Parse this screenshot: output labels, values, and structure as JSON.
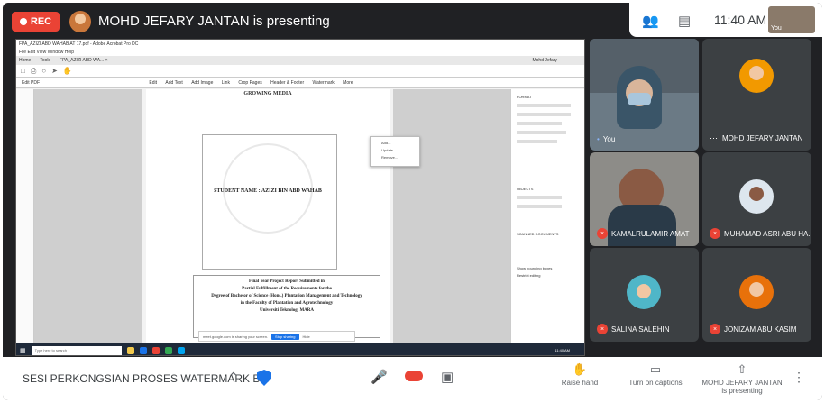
{
  "top": {
    "rec_label": "REC",
    "presenting_title": "MOHD JEFARY JANTAN is presenting",
    "clock": "11:40 AM",
    "self_label": "You"
  },
  "shared_screen": {
    "acrobat_title": "FPA_AZIZI ABD WAHAB AT 17.pdf - Adobe Acrobat Pro DC",
    "acrobat_menu": "File  Edit  View  Window  Help",
    "tabs": [
      "Home",
      "Tools",
      "FPA_AZIZI ABD WA... ×"
    ],
    "user_name": "Mohd Jefary",
    "edit_label": "Edit PDF",
    "toolbar_items": [
      "Edit",
      "Add Text",
      "Add Image",
      "Link",
      "Crop Pages",
      "Header & Footer",
      "Watermark",
      "More"
    ],
    "dropdown_items": [
      "Add...",
      "Update...",
      "Remove..."
    ],
    "page_heading": "GROWING MEDIA",
    "student_name": "STUDENT NAME : AZIZI BIN ABD WAHAB",
    "report_lines": [
      "Final Year Project Report Submitted in",
      "Partial Fulfillment of the Requirements for the",
      "Degree of Bachelor of Science (Hons.) Plantation Management and Technology",
      "in the Faculty of Plantation and Agrotechnology",
      "Universiti Teknologi MARA"
    ],
    "share_banner_text": "meet.google.com is sharing your screen.",
    "share_banner_stop": "Stop sharing",
    "share_banner_hide": "Hide",
    "right_panel_headings": [
      "FORMAT",
      "OBJECTS",
      "SCANNED DOCUMENTS"
    ],
    "right_panel_options": [
      "Show bounding boxes",
      "Restrict editing"
    ],
    "taskbar_search": "Type here to search",
    "taskbar_clock": "11:40 AM"
  },
  "participants": [
    {
      "name": "You",
      "muted": false
    },
    {
      "name": "MOHD JEFARY JANTAN",
      "muted": false
    },
    {
      "name": "KAMALRULAMIR AMAT",
      "muted": true
    },
    {
      "name": "MUHAMAD ASRI ABU HA...",
      "muted": true
    },
    {
      "name": "SALINA SALEHIN",
      "muted": true
    },
    {
      "name": "JONIZAM ABU KASIM",
      "muted": true
    }
  ],
  "bottom": {
    "meeting_name": "SESI PERKONGSIAN PROSES WATERMARK B...",
    "raise_hand": "Raise hand",
    "captions": "Turn on captions",
    "presenter_line1": "MOHD JEFARY JANTAN",
    "presenter_line2": "is presenting"
  },
  "colors": {
    "rec": "#ea4335",
    "background": "#202124",
    "tile": "#3c4043",
    "accent": "#1a73e8"
  }
}
